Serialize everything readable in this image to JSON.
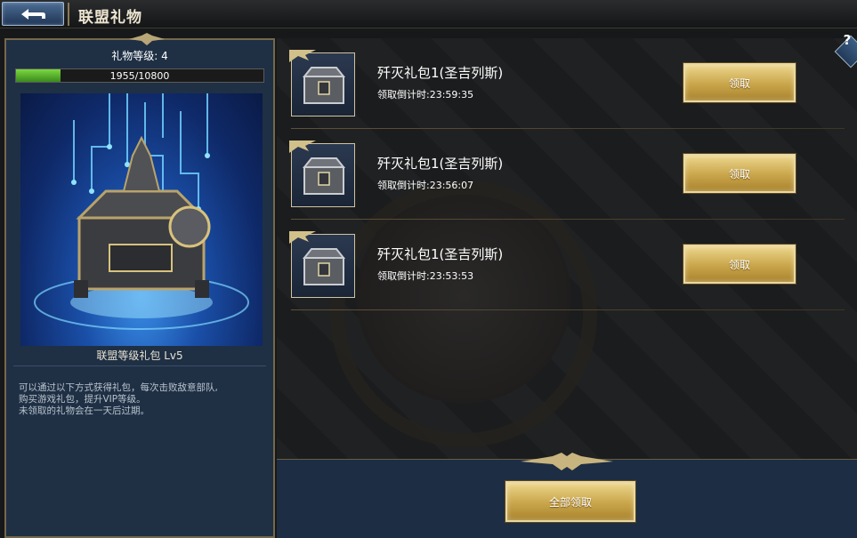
{
  "header": {
    "title": "联盟礼物",
    "back_icon": "back-arrow-icon"
  },
  "level_panel": {
    "level_label": "礼物等级: 4",
    "progress_text": "1955/10800",
    "progress_fraction": 0.181,
    "chest_caption": "联盟等级礼包 Lv5",
    "description": [
      "可以通过以下方式获得礼包，每次击败敌意部队,",
      "购买游戏礼包，提升VIP等级。",
      "未领取的礼物会在一天后过期。"
    ]
  },
  "help_icon": "?",
  "gifts": [
    {
      "name": "歼灭礼包1(圣吉列斯)",
      "timer": "领取倒计时:23:59:35",
      "button": "领取"
    },
    {
      "name": "歼灭礼包1(圣吉列斯)",
      "timer": "领取倒计时:23:56:07",
      "button": "领取"
    },
    {
      "name": "歼灭礼包1(圣吉列斯)",
      "timer": "领取倒计时:23:53:53",
      "button": "领取"
    }
  ],
  "footer": {
    "claim_all_label": "全部领取"
  },
  "colors": {
    "gold_button": "#c9a54a",
    "panel_blue": "#1f3045",
    "progress_green": "#5cb82e",
    "frame_gold": "#76684a"
  }
}
